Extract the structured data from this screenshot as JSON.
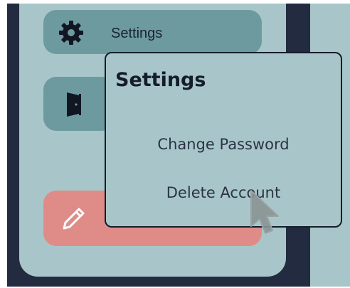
{
  "sidebar": {
    "settings_button": {
      "label": "Settings",
      "icon": "gear-icon"
    },
    "door_button": {
      "icon": "door-icon"
    },
    "edit_button": {
      "icon": "pencil-icon"
    }
  },
  "popover": {
    "title": "Settings",
    "items": [
      {
        "label": "Change Password"
      },
      {
        "label": "Delete Account"
      }
    ]
  },
  "colors": {
    "background_dark": "#232b40",
    "sidebar": "#a8c6c9",
    "button_teal": "#6d9a9f",
    "button_danger": "#df8c88",
    "text_dark": "#151c2a"
  }
}
